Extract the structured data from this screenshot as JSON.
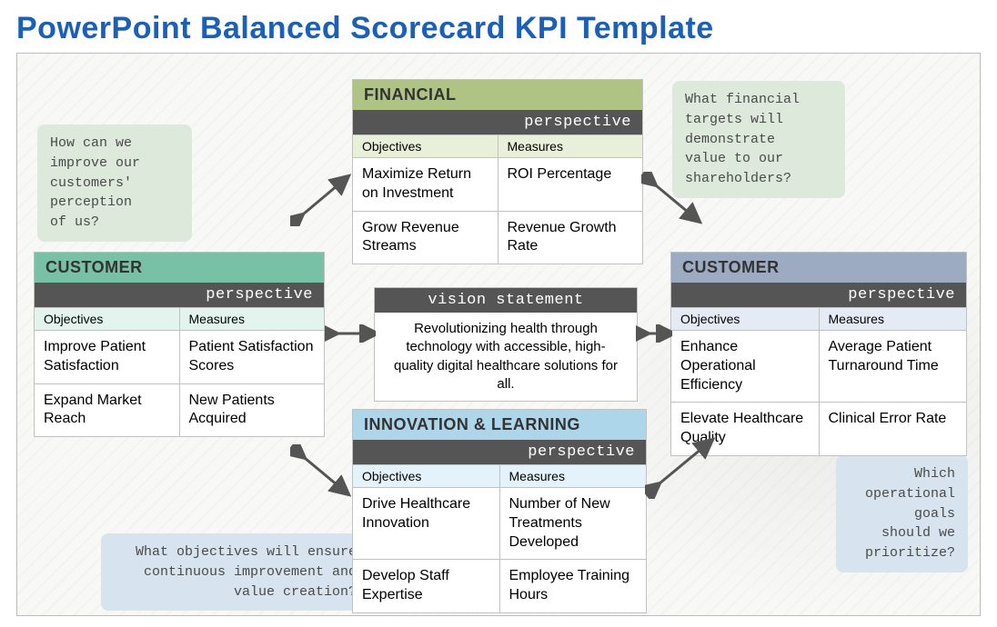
{
  "title": "PowerPoint Balanced Scorecard KPI Template",
  "perspective_label": "perspective",
  "col_objectives": "Objectives",
  "col_measures": "Measures",
  "vision": {
    "header": "vision statement",
    "body": "Revolutionizing health through technology with accessible, high-quality digital healthcare solutions for all."
  },
  "notes": {
    "customer_q": "How can we\nimprove our\ncustomers'\nperception\nof us?",
    "financial_q": "What financial\ntargets will\ndemonstrate\nvalue to our\nshareholders?",
    "innovation_q": "What objectives will ensure\ncontinuous improvement and\nvalue creation?",
    "internal_q": "Which\noperational\ngoals\nshould we\nprioritize?"
  },
  "cards": {
    "financial": {
      "title": "FINANCIAL",
      "rows": [
        {
          "obj": "Maximize Return on Investment",
          "meas": "ROI Percentage"
        },
        {
          "obj": "Grow Revenue Streams",
          "meas": "Revenue Growth Rate"
        }
      ]
    },
    "customer_left": {
      "title": "CUSTOMER",
      "rows": [
        {
          "obj": "Improve Patient Satisfaction",
          "meas": "Patient Satisfaction Scores"
        },
        {
          "obj": "Expand Market Reach",
          "meas": "New Patients Acquired"
        }
      ]
    },
    "customer_right": {
      "title": "CUSTOMER",
      "rows": [
        {
          "obj": "Enhance Operational Efficiency",
          "meas": "Average Patient Turnaround Time"
        },
        {
          "obj": "Elevate Healthcare Quality",
          "meas": "Clinical Error Rate"
        }
      ]
    },
    "innovation": {
      "title": "INNOVATION & LEARNING",
      "rows": [
        {
          "obj": "Drive Healthcare Innovation",
          "meas": "Number of New Treatments Developed"
        },
        {
          "obj": "Develop Staff Expertise",
          "meas": "Employee Training Hours"
        }
      ]
    }
  }
}
